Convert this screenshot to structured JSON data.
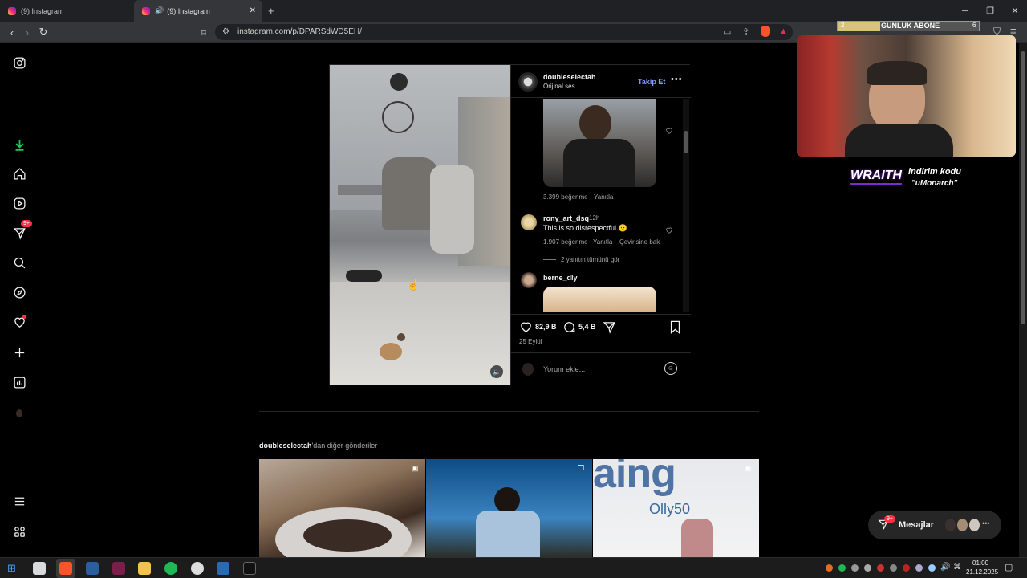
{
  "browser": {
    "tabs": [
      {
        "title": "(9) Instagram",
        "active": false
      },
      {
        "title": "(9) Instagram",
        "active": true
      }
    ],
    "new_tab": "+",
    "url": "instagram.com/p/DPARSdWD5EH/"
  },
  "stream_overlay": {
    "goal_left": "2",
    "goal_label": "GUNLUK ABONE",
    "goal_right": "6",
    "sponsor_brand": "WRAITH",
    "sponsor_line1": "indirim kodu",
    "sponsor_line2": "\"uMonarch\""
  },
  "sidebar": {
    "notification_badge": "9+"
  },
  "post": {
    "author": "doubleselectah",
    "audio": "Orijinal ses",
    "follow_label": "Takip Et",
    "comments": [
      {
        "meta_likes": "3.399 beğenme",
        "meta_reply": "Yanıtla"
      },
      {
        "user": "rony_art_dsq",
        "time": "12h",
        "text": "This is so disrespectful 😟",
        "likes": "1.907 beğenme",
        "reply": "Yanıtla",
        "translate": "Çevirisine bak",
        "view_replies": "2 yanıtın tümünü gör"
      },
      {
        "user": "berne_dly"
      }
    ],
    "like_count": "82,9 B",
    "comment_count": "5,4 B",
    "date": "25 Eylül",
    "comment_placeholder": "Yorum ekle..."
  },
  "more_posts": {
    "author": "doubleselectah",
    "suffix": "'dan diğer gönderiler",
    "thumb3_text": "Olly50"
  },
  "messages": {
    "badge": "9+",
    "label": "Mesajlar"
  },
  "taskbar": {
    "time": "01:00",
    "date": "21.12.2025"
  }
}
